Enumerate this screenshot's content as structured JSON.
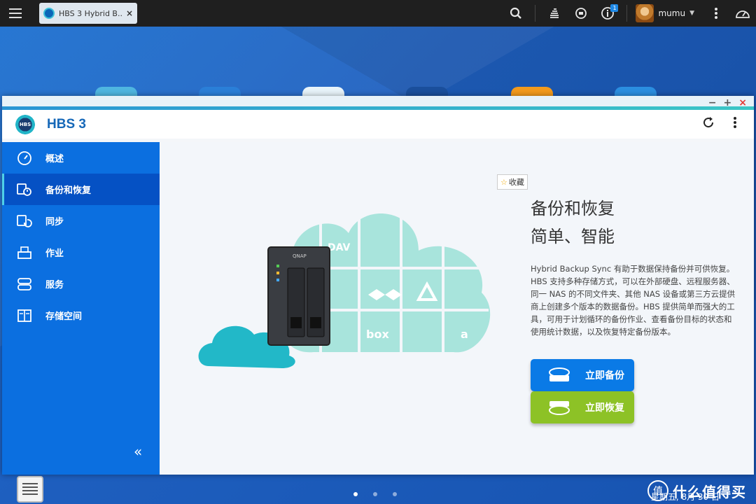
{
  "taskbar": {
    "tab_title": "HBS 3 Hybrid B...",
    "tab_close": "×",
    "notification_count": "1",
    "username": "mumu"
  },
  "window": {
    "controls": {
      "minimize": "−",
      "maximize": "+",
      "close": "×"
    }
  },
  "app": {
    "title": "HBS 3",
    "logo_text": "HBS"
  },
  "sidebar": {
    "items": [
      {
        "label": "概述",
        "icon": "dashboard-icon",
        "active": false
      },
      {
        "label": "备份和恢复",
        "icon": "backup-restore-icon",
        "active": true
      },
      {
        "label": "同步",
        "icon": "sync-icon",
        "active": false
      },
      {
        "label": "作业",
        "icon": "jobs-icon",
        "active": false
      },
      {
        "label": "服务",
        "icon": "services-icon",
        "active": false
      },
      {
        "label": "存储空间",
        "icon": "storage-icon",
        "active": false
      }
    ],
    "collapse": "«"
  },
  "main": {
    "favorite_label": "收藏",
    "headline_1": "备份和恢复",
    "headline_2": "简单、智能",
    "description": "Hybrid Backup Sync 有助于数据保持备份并可供恢复。HBS 支持多种存储方式，可以在外部硬盘、远程服务器、同一 NAS 的不同文件夹、其他 NAS 设备或第三方云提供商上创建多个版本的数据备份。HBS 提供简单而强大的工具，可用于计划循环的备份作业、查看备份目标的状态和使用统计数据，以及恢复特定备份版本。",
    "backup_now": "立即备份",
    "restore_now": "立即恢复",
    "nas_brand": "QNAP",
    "cloud_tiles": [
      "DAV",
      "box",
      "a"
    ]
  },
  "desktop": {
    "watermark_text": "什么值得买",
    "watermark_logo": "值",
    "date_text": "星期五, 8月 30 日"
  },
  "colors": {
    "sidebar": "#0b6fe0",
    "sidebar_active": "#0551c4",
    "backup_button": "#0a7ae6",
    "restore_button": "#8dc226",
    "accent_title": "#1668b8"
  }
}
